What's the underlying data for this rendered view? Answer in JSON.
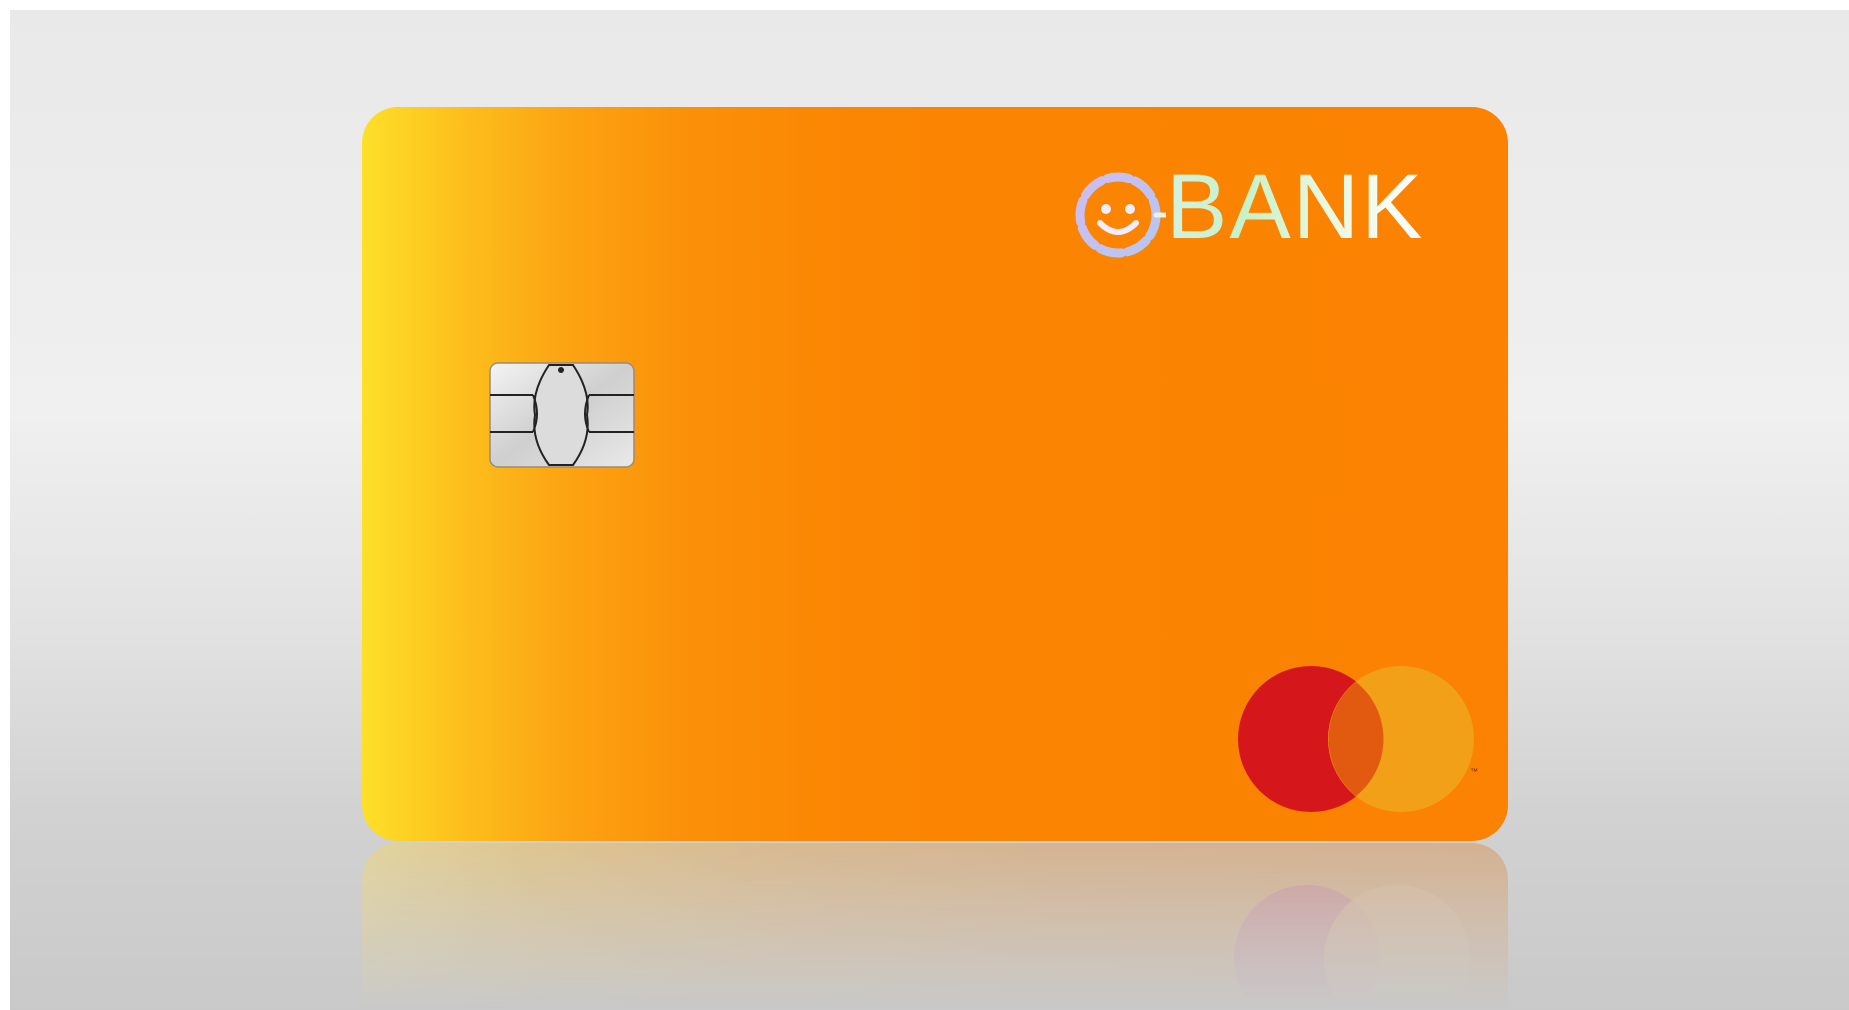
{
  "card": {
    "brand_name": "BANK",
    "network": "mastercard",
    "network_trademark": "™",
    "colors": {
      "card_gradient_start": "#fde028",
      "card_gradient_end": "#fb8202",
      "mastercard_red": "#d5171c",
      "mastercard_yellow": "#f0a31a",
      "mastercard_overlap": "#e25a0f",
      "logo_face_ring": "#c9b9ea",
      "logo_text": "#d4f2e0"
    },
    "icons": [
      "smiley-face-icon",
      "emv-chip-icon",
      "mastercard-logo-icon"
    ]
  }
}
